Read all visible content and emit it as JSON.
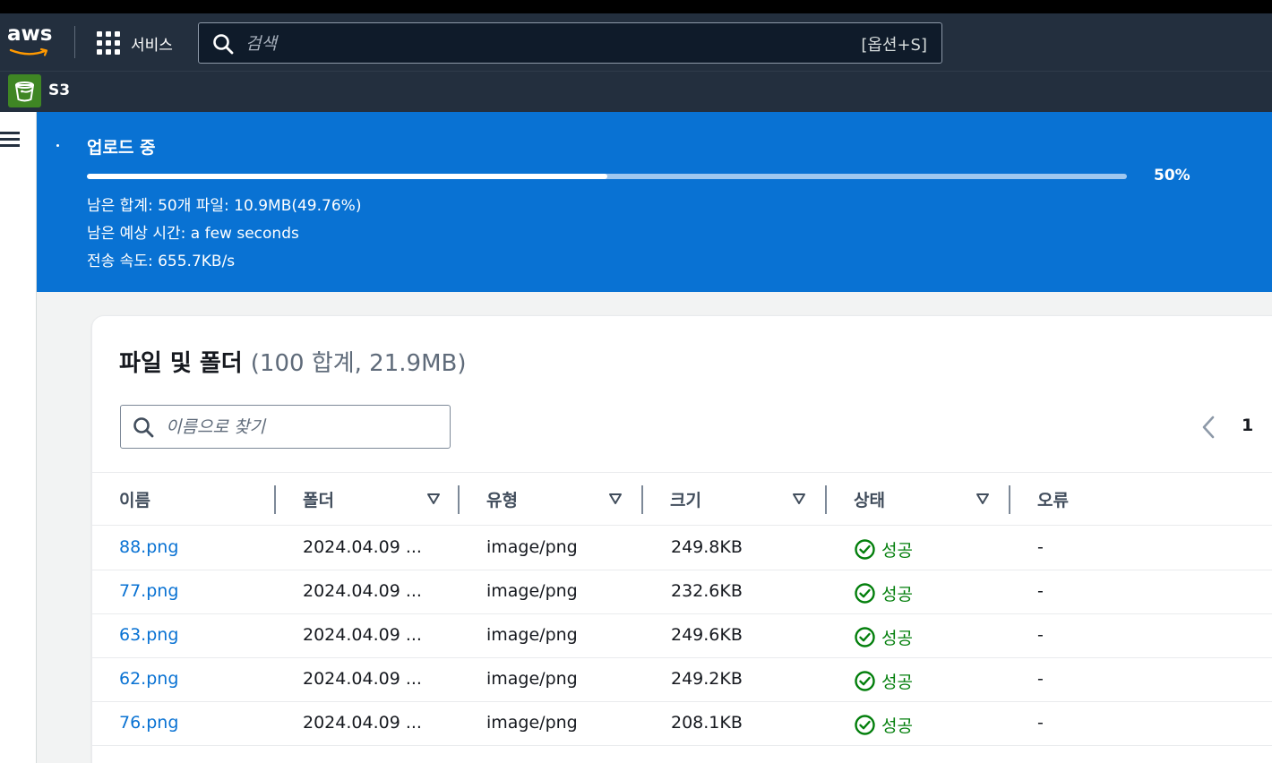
{
  "topnav": {
    "logo_text": "aws",
    "services_label": "서비스",
    "search_placeholder": "검색",
    "search_shortcut": "[옵션+S]"
  },
  "subnav": {
    "service_name": "S3"
  },
  "flash": {
    "title": "업로드 중",
    "progress_percent": 50,
    "progress_label": "50%",
    "remaining": "남은 합계: 50개 파일: 10.9MB(49.76%)",
    "eta": "남은 예상 시간: a few seconds",
    "speed": "전송 속도: 655.7KB/s"
  },
  "panel": {
    "title": "파일 및 폴더",
    "count": "(100 합계, 21.9MB)",
    "filter_placeholder": "이름으로 찾기",
    "page_number": "1"
  },
  "table": {
    "columns": [
      "이름",
      "폴더",
      "유형",
      "크기",
      "상태",
      "오류"
    ],
    "rows": [
      {
        "name": "88.png",
        "folder": "2024.04.09 ...",
        "type": "image/png",
        "size": "249.8KB",
        "status": "성공",
        "error": "-"
      },
      {
        "name": "77.png",
        "folder": "2024.04.09 ...",
        "type": "image/png",
        "size": "232.6KB",
        "status": "성공",
        "error": "-"
      },
      {
        "name": "63.png",
        "folder": "2024.04.09 ...",
        "type": "image/png",
        "size": "249.6KB",
        "status": "성공",
        "error": "-"
      },
      {
        "name": "62.png",
        "folder": "2024.04.09 ...",
        "type": "image/png",
        "size": "249.2KB",
        "status": "성공",
        "error": "-"
      },
      {
        "name": "76.png",
        "folder": "2024.04.09 ...",
        "type": "image/png",
        "size": "208.1KB",
        "status": "성공",
        "error": "-"
      }
    ]
  },
  "colors": {
    "nav_bg": "#232f3e",
    "flash_bg": "#0972d3",
    "link": "#0972d3",
    "success": "#037f0c",
    "s3_icon_bg": "#3f8624"
  },
  "icons": [
    "aws-logo",
    "apps-grid-icon",
    "search-icon",
    "s3-bucket-icon",
    "hamburger-menu-icon",
    "chevron-left-icon",
    "sort-caret-icon",
    "status-success-icon"
  ]
}
